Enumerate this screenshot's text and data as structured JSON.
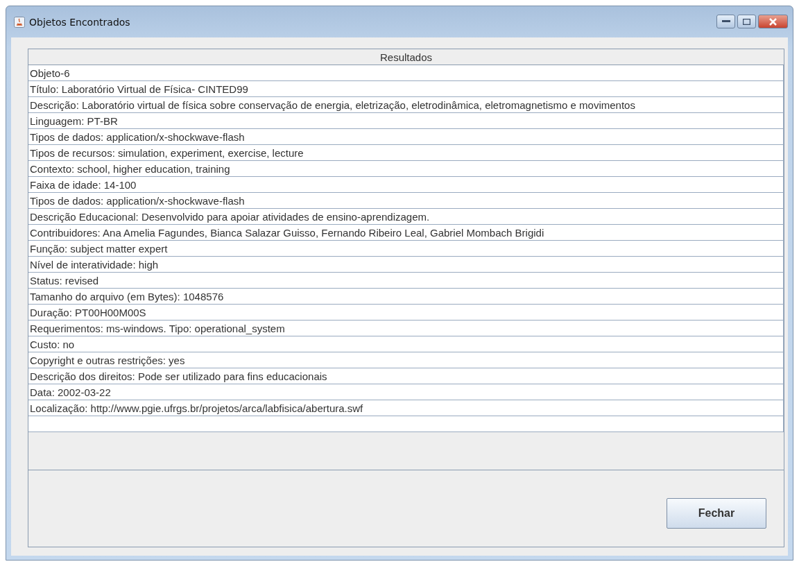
{
  "window": {
    "title": "Objetos Encontrados"
  },
  "table": {
    "columns": [
      "Resultados"
    ],
    "rows": [
      "Objeto-6",
      "Título: Laboratório Virtual de Física- CINTED99",
      "Descrição: Laboratório virtual de física sobre conservação de energia, eletrização, eletrodinâmica, eletromagnetismo e movimentos",
      "Linguagem: PT-BR",
      "Tipos de dados: application/x-shockwave-flash",
      "Tipos de recursos: simulation, experiment, exercise, lecture",
      "Contexto: school, higher education, training",
      "Faixa de idade: 14-100",
      "Tipos de dados: application/x-shockwave-flash",
      "Descrição Educacional: Desenvolvido para apoiar atividades de ensino-aprendizagem.",
      "Contribuidores: Ana Amelia Fagundes, Bianca Salazar Guisso, Fernando Ribeiro Leal, Gabriel Mombach Brigidi",
      "Função: subject matter expert",
      "Nível de interatividade: high",
      "Status: revised",
      "Tamanho do arquivo (em Bytes): 1048576",
      "Duração: PT00H00M00S",
      "Requerimentos: ms-windows. Tipo: operational_system",
      "Custo: no",
      "Copyright e outras restrições: yes",
      "Descrição dos direitos: Pode ser utilizado para fins educacionais",
      "Data: 2002-03-22",
      "Localização: http://www.pgie.ufrgs.br/projetos/arca/labfisica/abertura.swf"
    ]
  },
  "buttons": [
    "Fechar"
  ]
}
